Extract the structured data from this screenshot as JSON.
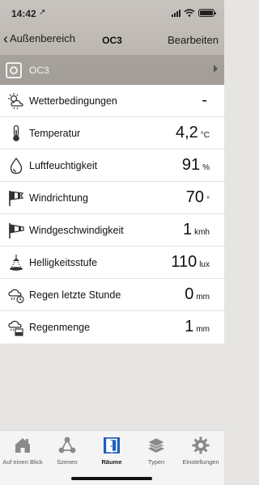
{
  "status": {
    "time": "14:42",
    "location_glyph": "↗"
  },
  "nav": {
    "back_label": "Außenbereich",
    "title": "OC3",
    "edit_label": "Bearbeiten"
  },
  "room": {
    "label": "OC3"
  },
  "rows": [
    {
      "label": "Wetterbedingungen",
      "value": "-",
      "unit": "",
      "icon": "weather-icon"
    },
    {
      "label": "Temperatur",
      "value": "4,2",
      "unit": "°C",
      "icon": "thermometer-icon"
    },
    {
      "label": "Luftfeuchtigkeit",
      "value": "91",
      "unit": "%",
      "icon": "humidity-drop-icon"
    },
    {
      "label": "Windrichtung",
      "value": "70",
      "unit": "°",
      "icon": "wind-direction-icon"
    },
    {
      "label": "Windgeschwindigkeit",
      "value": "1",
      "unit": "kmh",
      "icon": "windsock-icon"
    },
    {
      "label": "Helligkeitsstufe",
      "value": "110",
      "unit": "lux",
      "icon": "brightness-lamp-icon"
    },
    {
      "label": "Regen letzte Stunde",
      "value": "0",
      "unit": "mm",
      "icon": "rain-hour-icon"
    },
    {
      "label": "Regenmenge",
      "value": "1",
      "unit": "mm",
      "icon": "rain-amount-icon"
    }
  ],
  "tabs": [
    {
      "label": "Auf einen Blick",
      "icon": "home-icon",
      "active": false
    },
    {
      "label": "Szenen",
      "icon": "scenes-icon",
      "active": false
    },
    {
      "label": "Räume",
      "icon": "rooms-icon",
      "active": true
    },
    {
      "label": "Typen",
      "icon": "types-icon",
      "active": false
    },
    {
      "label": "Einstellungen",
      "icon": "settings-gear-icon",
      "active": false
    }
  ],
  "colors": {
    "active_tab": "#1f5fbf",
    "tab_icon": "#8a8a8a",
    "room_bar": "#9a948f"
  }
}
